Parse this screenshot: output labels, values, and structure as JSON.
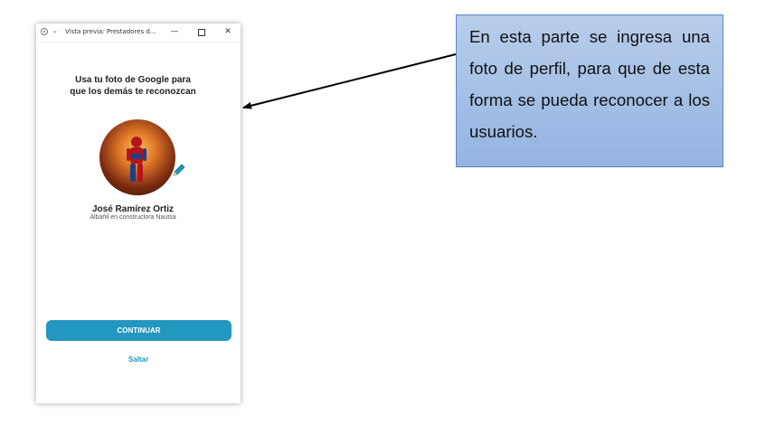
{
  "window": {
    "title": "Vista previa: Prestadores d...",
    "controls": {
      "minimize": "—",
      "close": "✕"
    }
  },
  "screen": {
    "headline_line1": "Usa tu foto de Google para",
    "headline_line2": "que los demás te reconozcan",
    "user_name": "José Ramírez Ortiz",
    "user_role": "Albañil en constructora Nautsa",
    "continue_label": "CONTINUAR",
    "skip_label": "Saltar",
    "avatar_alt": "Foto de perfil"
  },
  "callout": {
    "text": "En esta parte se ingresa una foto de perfil, para que de esta forma se pueda reconocer a los usuarios."
  },
  "colors": {
    "accent": "#2297bf",
    "callout_fill": "#a4bfe6",
    "callout_border": "#5a87c5"
  },
  "icons": [
    "app-icon",
    "chevron-down-icon",
    "minimize-icon",
    "maximize-icon",
    "close-icon",
    "pencil-icon"
  ]
}
